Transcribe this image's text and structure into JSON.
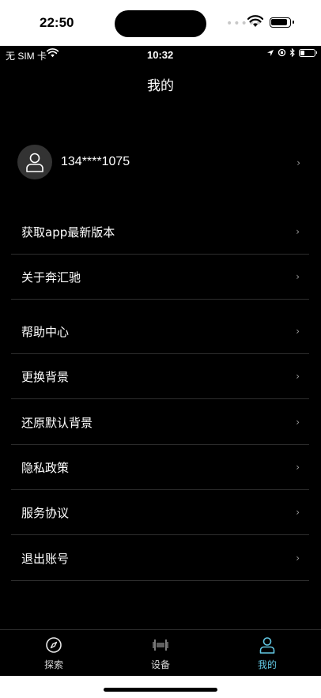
{
  "outer_status": {
    "time": "22:50",
    "dots": "•••••"
  },
  "inner_status": {
    "carrier": "无 SIM 卡",
    "time": "10:32"
  },
  "nav": {
    "title": "我的"
  },
  "profile": {
    "phone": "134****1075"
  },
  "menu": [
    {
      "label": "获取app最新版本"
    },
    {
      "label": "关于奔汇驰"
    },
    {
      "label": "帮助中心"
    },
    {
      "label": "更换背景"
    },
    {
      "label": "还原默认背景"
    },
    {
      "label": "隐私政策"
    },
    {
      "label": "服务协议"
    },
    {
      "label": "退出账号"
    }
  ],
  "chevron": "›",
  "tabs": [
    {
      "label": "探索",
      "icon": "compass-icon"
    },
    {
      "label": "设备",
      "icon": "device-icon"
    },
    {
      "label": "我的",
      "icon": "person-icon",
      "active": true
    }
  ],
  "colors": {
    "background": "#000000",
    "accent": "#62c7e3",
    "divider": "#2e2e2e"
  }
}
